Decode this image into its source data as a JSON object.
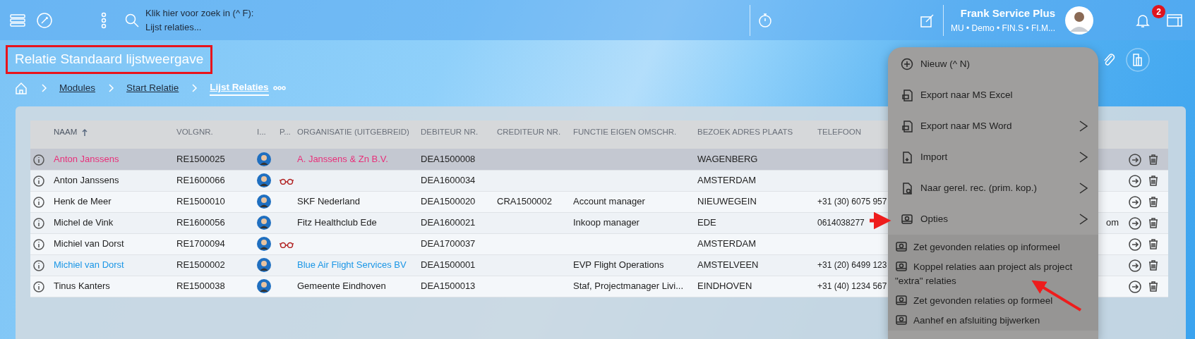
{
  "topbar": {
    "search_hint": [
      "Klik hier voor zoek in (^ F):",
      "Lijst relaties..."
    ],
    "user": {
      "name": "Frank Service Plus",
      "details": "MU • Demo • FIN.S • FI.M..."
    },
    "notifications": "2"
  },
  "page_title": "Relatie Standaard lijstweergave",
  "breadcrumb": [
    {
      "label": "Modules",
      "current": false
    },
    {
      "label": "Start Relatie",
      "current": false
    },
    {
      "label": "Lijst Relaties",
      "current": true
    }
  ],
  "table": {
    "columns": [
      {
        "label": "NAAM",
        "sorted": true
      },
      {
        "label": "VOLGNR.",
        "sorted": false
      },
      {
        "label": "I...",
        "sorted": false
      },
      {
        "label": "P...",
        "sorted": false
      },
      {
        "label": "ORGANISATIE (UITGEBREID)",
        "sorted": false
      },
      {
        "label": "DEBITEUR NR.",
        "sorted": false
      },
      {
        "label": "CREDITEUR NR.",
        "sorted": false
      },
      {
        "label": "FUNCTIE EIGEN OMSCHR.",
        "sorted": false
      },
      {
        "label": "BEZOEK ADRES PLAATS",
        "sorted": false
      },
      {
        "label": "TELEFOON",
        "sorted": false
      }
    ],
    "rows": [
      {
        "selected": true,
        "color": "#e8307a",
        "name": "Anton Janssens",
        "volgnr": "RE1500025",
        "glasses": false,
        "organisatie": "A. Janssens & Zn B.V.",
        "debiteur": "DEA1500008",
        "crediteur": "",
        "functie": "",
        "plaats": "WAGENBERG",
        "telefoon": "",
        "column_12": ""
      },
      {
        "selected": false,
        "color": "#222222",
        "name": "Anton Janssens",
        "volgnr": "RE1600066",
        "glasses": true,
        "organisatie": "",
        "debiteur": "DEA1600034",
        "crediteur": "",
        "functie": "",
        "plaats": "AMSTERDAM",
        "telefoon": "",
        "column_12": ""
      },
      {
        "selected": false,
        "color": "#222222",
        "name": "Henk de Meer",
        "volgnr": "RE1500010",
        "glasses": false,
        "organisatie": "SKF Nederland",
        "debiteur": "DEA1500020",
        "crediteur": "CRA1500002",
        "functie": "Account manager",
        "plaats": "NIEUWEGEIN",
        "telefoon": "+31 (30) 6075 957",
        "column_12": ""
      },
      {
        "selected": false,
        "color": "#222222",
        "name": "Michel de Vink",
        "volgnr": "RE1600056",
        "glasses": false,
        "organisatie": "Fitz Healthclub Ede",
        "debiteur": "DEA1600021",
        "crediteur": "",
        "functie": "Inkoop manager",
        "plaats": "EDE",
        "telefoon": "0614038277",
        "column_12": "om"
      },
      {
        "selected": false,
        "color": "#222222",
        "name": "Michiel van Dorst",
        "volgnr": "RE1700094",
        "glasses": true,
        "organisatie": "",
        "debiteur": "DEA1700037",
        "crediteur": "",
        "functie": "",
        "plaats": "AMSTERDAM",
        "telefoon": "",
        "column_12": ""
      },
      {
        "selected": false,
        "color": "#1a96e6",
        "name": "Michiel van Dorst",
        "volgnr": "RE1500002",
        "glasses": false,
        "organisatie": "Blue Air Flight Services BV",
        "debiteur": "DEA1500001",
        "crediteur": "",
        "functie": "EVP Flight Operations",
        "plaats": "AMSTELVEEN",
        "telefoon": "+31 (20) 6499 123",
        "column_12": ""
      },
      {
        "selected": false,
        "color": "#222222",
        "name": "Tinus Kanters",
        "volgnr": "RE1500038",
        "glasses": false,
        "organisatie": "Gemeente Eindhoven",
        "debiteur": "DEA1500013",
        "crediteur": "",
        "functie": "Staf, Projectmanager Livi...",
        "plaats": "EINDHOVEN",
        "telefoon": "+31 (40) 1234 567",
        "column_12": ""
      }
    ]
  },
  "menu": {
    "items": [
      {
        "kind": "main",
        "label": "Nieuw (^ N)",
        "submenu": false
      },
      {
        "kind": "main",
        "label": "Export naar MS Excel",
        "submenu": false
      },
      {
        "kind": "main",
        "label": "Export naar MS Word",
        "submenu": true
      },
      {
        "kind": "main",
        "label": "Import",
        "submenu": true
      },
      {
        "kind": "main",
        "label": "Naar gerel. rec. (prim. kop.)",
        "submenu": true
      },
      {
        "kind": "main",
        "label": "Opties",
        "submenu": true
      },
      {
        "kind": "sub",
        "label": "Zet gevonden relaties op informeel"
      },
      {
        "kind": "sub",
        "label": "Koppel relaties aan project als project \"extra\" relaties"
      },
      {
        "kind": "sub",
        "label": "Zet gevonden relaties op formeel"
      },
      {
        "kind": "sub",
        "label": "Aanhef en afsluiting bijwerken"
      }
    ]
  }
}
